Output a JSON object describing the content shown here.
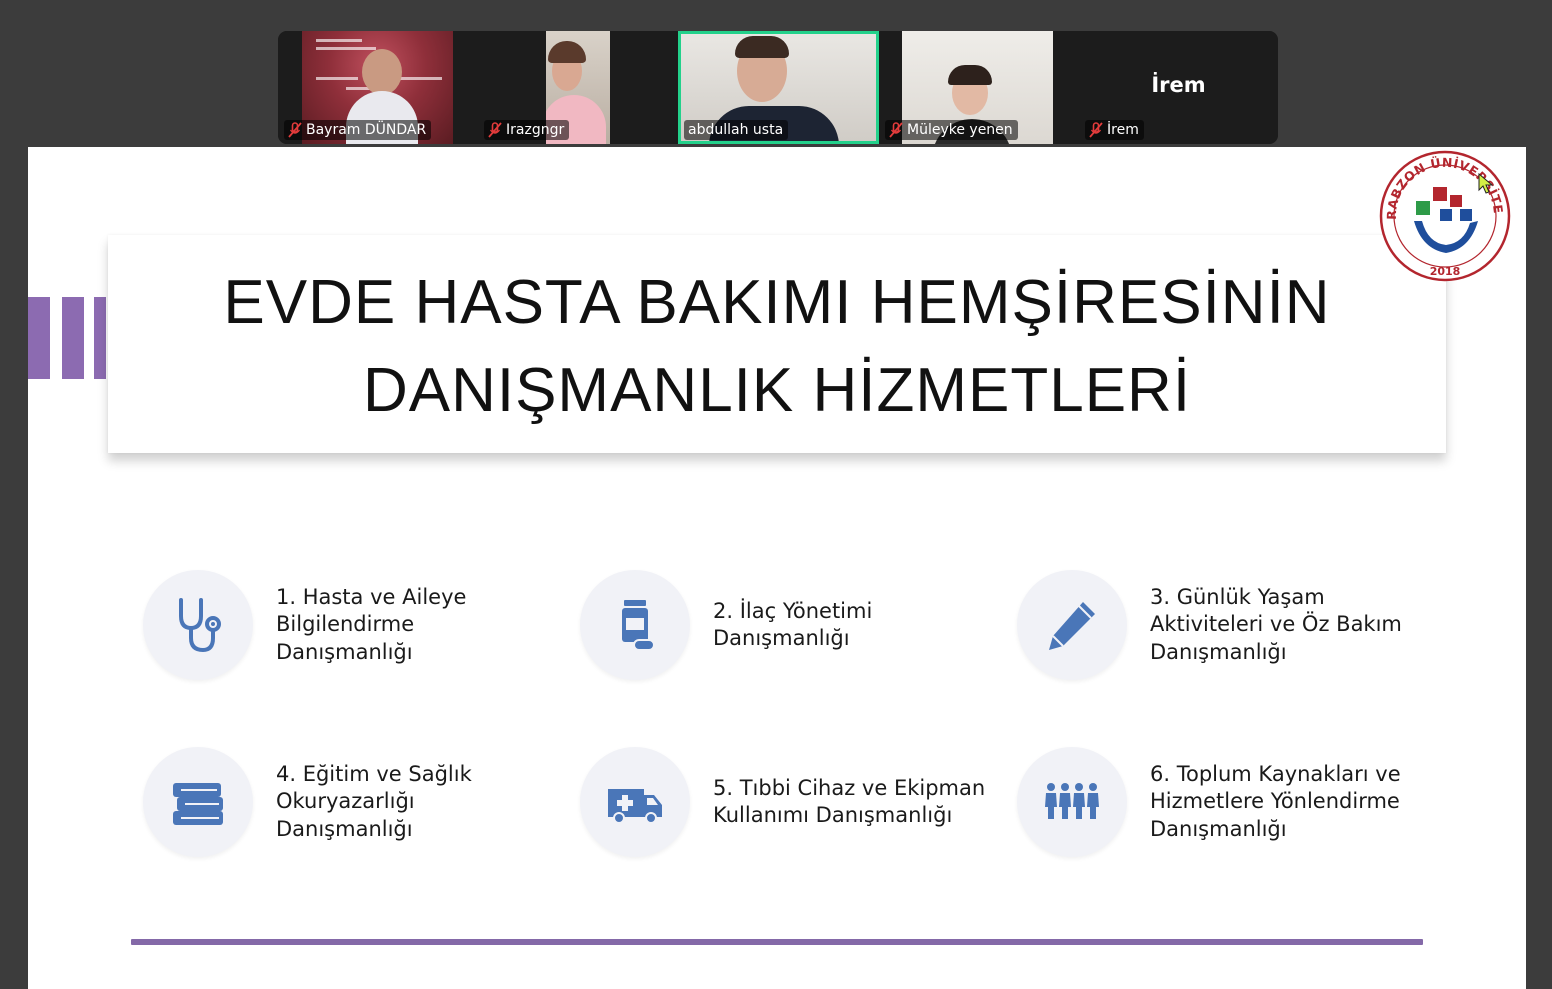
{
  "participants": [
    {
      "name": "Bayram DÜNDAR",
      "muted": true,
      "video": true,
      "active": false
    },
    {
      "name": "Irazgngr",
      "muted": true,
      "video": true,
      "active": false
    },
    {
      "name": "abdullah usta",
      "muted": false,
      "video": true,
      "active": true
    },
    {
      "name": "Müleyke yenen",
      "muted": true,
      "video": true,
      "active": false
    },
    {
      "name": "İrem",
      "muted": true,
      "video": false,
      "active": false
    }
  ],
  "slide": {
    "title_line1": "EVDE HASTA BAKIMI HEMŞİRESİNİN",
    "title_line2": "DANIŞMANLIK HİZMETLERİ",
    "logo": {
      "text_top": "TRABZON ÜNİVERSİTESİ",
      "year": "2018",
      "icon": "university-logo"
    },
    "services": [
      {
        "text": "1. Hasta ve Aileye\nBilgilendirme\nDanışmanlığı",
        "icon": "stethoscope-icon"
      },
      {
        "text": "2. İlaç Yönetimi\nDanışmanlığı",
        "icon": "medicine-bottle-icon"
      },
      {
        "text": "3. Günlük Yaşam\nAktiviteleri ve Öz Bakım\nDanışmanlığı",
        "icon": "pencil-icon"
      },
      {
        "text": "4. Eğitim ve Sağlık\nOkuryazarlığı\nDanışmanlığı",
        "icon": "books-icon"
      },
      {
        "text": "5. Tıbbi Cihaz ve Ekipman\nKullanımı Danışmanlığı",
        "icon": "ambulance-icon"
      },
      {
        "text": "6. Toplum Kaynakları ve\nHizmetlere Yönlendirme\nDanışmanlığı",
        "icon": "people-icon"
      }
    ]
  },
  "colors": {
    "accent_purple": "#8c6bb1",
    "icon_blue": "#4a76b8",
    "active_speaker": "#23d18b",
    "logo_red": "#b3262e",
    "logo_blue": "#1f4e9c",
    "logo_green": "#2e9b48"
  }
}
